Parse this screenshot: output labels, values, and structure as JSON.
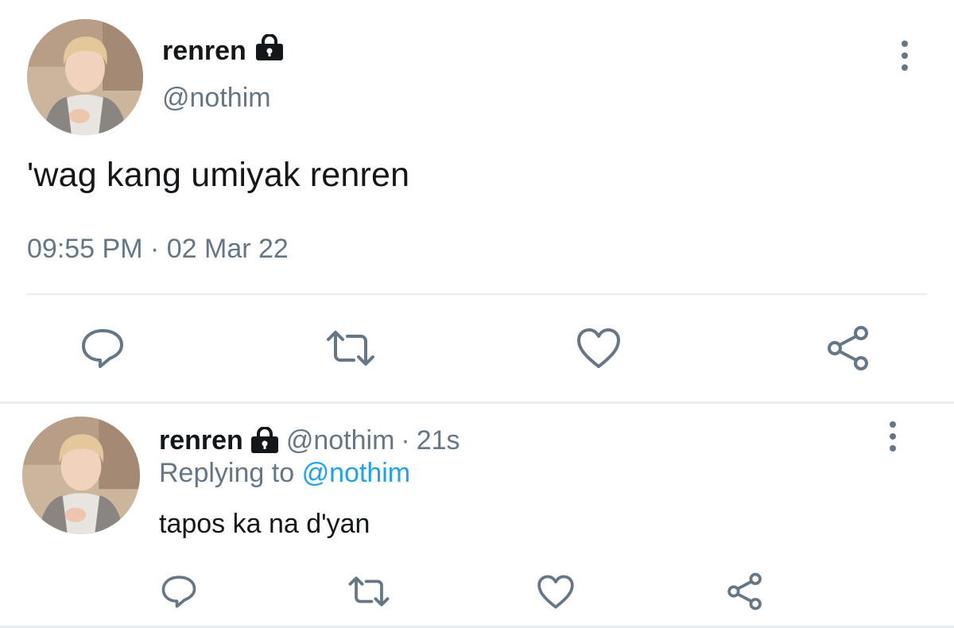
{
  "main_tweet": {
    "display_name": "renren",
    "handle": "@nothim",
    "text": "'wag kang umiyak renren",
    "timestamp": "09:55 PM · 02 Mar 22",
    "protected_icon": "lock-icon",
    "actions": [
      "reply-icon",
      "retweet-icon",
      "like-icon",
      "share-icon"
    ]
  },
  "reply_tweet": {
    "display_name": "renren",
    "handle": "@nothim",
    "separator": "·",
    "age": "21s",
    "replying_prefix": "Replying to",
    "replying_to": "@nothim",
    "text": "tapos ka na d'yan",
    "protected_icon": "lock-icon",
    "actions": [
      "reply-icon",
      "retweet-icon",
      "like-icon",
      "share-icon"
    ]
  },
  "colors": {
    "text": "#14171a",
    "secondary": "#657786",
    "link": "#1da1f2",
    "divider": "#e6ecf0",
    "icon": "#657786"
  }
}
